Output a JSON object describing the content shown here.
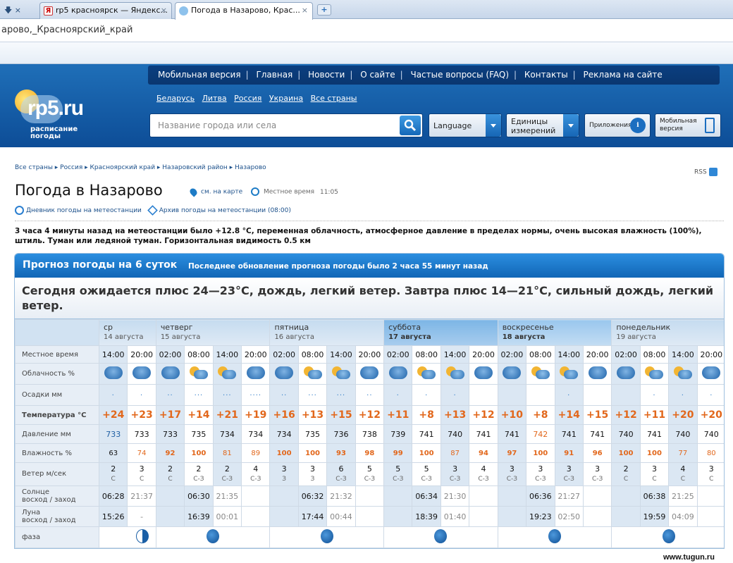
{
  "browser": {
    "tabs": [
      {
        "label": "×",
        "active": false
      },
      {
        "label": "rp5 красноярск — Яндекс...",
        "active": false
      },
      {
        "label": "Погода в Назарово, Крас...",
        "active": true
      }
    ],
    "address": "арово,_Красноярский_край"
  },
  "site": {
    "brand": "rp5.ru",
    "brand_sub1": "расписание",
    "brand_sub2": "погоды",
    "nav": [
      "Мобильная версия",
      "Главная",
      "Новости",
      "О сайте",
      "Частые вопросы (FAQ)",
      "Контакты",
      "Реклама на сайте"
    ],
    "countries": [
      "Беларусь",
      "Литва",
      "Россия",
      "Украина",
      "Все страны"
    ],
    "search_placeholder": "Название города или села",
    "language_label": "Language",
    "units_label_1": "Единицы",
    "units_label_2": "измерений",
    "apps_label": "Приложения",
    "mobile_label_1": "Мобильная",
    "mobile_label_2": "версия"
  },
  "page": {
    "breadcrumb": "Все страны ▸ Россия ▸ Красноярский край ▸ Назаровский район ▸ Назарово",
    "rss": "RSS",
    "title": "Погода в Назарово",
    "on_map": "см. на карте",
    "local_time_label": "Местное время",
    "local_time": "11:05",
    "diary_link": "Дневник погоды на метеостанции",
    "archive_link": "Архив погоды на метеостанции (08:00)",
    "observation": "3 часа 4 минуты назад на метеостанции было +12.8 °C, переменная облачность, атмосферное давление в пределах нормы, очень высокая влажность (100%), штиль. Туман или ледяной туман. Горизонтальная видимость 0.5 км"
  },
  "forecast": {
    "title": "Прогноз погоды на 6 суток",
    "updated": "Последнее обновление прогноза погоды было 2 часа 55 минут назад",
    "today": "Сегодня ожидается плюс 24—23°С, дождь, легкий ветер. Завтра плюс 14—21°С, сильный дождь, легкий ветер.",
    "labels": {
      "local_time": "Местное время",
      "cloudiness": "Облачность %",
      "precip": "Осадки мм",
      "temp": "Температура °C",
      "pressure": "Давление мм",
      "humidity": "Влажность %",
      "wind": "Ветер м/сек",
      "sun_1": "Солнце",
      "sun_2": "восход / заход",
      "moon_1": "Луна",
      "moon_2": "восход / заход",
      "phase": "фаза"
    },
    "days": [
      {
        "name": "ср",
        "date": "14 августа"
      },
      {
        "name": "четверг",
        "date": "15 августа"
      },
      {
        "name": "пятница",
        "date": "16 августа"
      },
      {
        "name": "суббота",
        "date": "17 августа"
      },
      {
        "name": "воскресенье",
        "date": "18 августа"
      },
      {
        "name": "понедельник",
        "date": "19 августа"
      }
    ],
    "hours": [
      "14:00",
      "20:00",
      "02:00",
      "08:00",
      "14:00",
      "20:00",
      "02:00",
      "08:00",
      "14:00",
      "20:00",
      "02:00",
      "08:00",
      "14:00",
      "20:00",
      "02:00",
      "08:00",
      "14:00",
      "20:00",
      "02:00",
      "08:00",
      "14:00",
      "20:00"
    ],
    "temps": [
      "+24",
      "+23",
      "+17",
      "+14",
      "+21",
      "+19",
      "+16",
      "+13",
      "+15",
      "+12",
      "+11",
      "+8",
      "+13",
      "+12",
      "+10",
      "+8",
      "+14",
      "+15",
      "+12",
      "+11",
      "+20",
      "+20"
    ],
    "pressure": [
      "733",
      "733",
      "733",
      "735",
      "734",
      "734",
      "734",
      "735",
      "736",
      "738",
      "739",
      "741",
      "740",
      "741",
      "741",
      "742",
      "741",
      "741",
      "740",
      "741",
      "740",
      "740"
    ],
    "humidity": [
      "63",
      "74",
      "92",
      "100",
      "81",
      "89",
      "100",
      "100",
      "93",
      "98",
      "99",
      "100",
      "87",
      "94",
      "97",
      "100",
      "91",
      "96",
      "100",
      "100",
      "77",
      "80"
    ],
    "wind_speed": [
      "2",
      "3",
      "2",
      "2",
      "2",
      "4",
      "3",
      "3",
      "6",
      "5",
      "5",
      "5",
      "3",
      "4",
      "3",
      "3",
      "3",
      "3",
      "2",
      "3",
      "4",
      "3"
    ],
    "wind_dir": [
      "С",
      "С",
      "С",
      "С-З",
      "С-З",
      "С-З",
      "З",
      "З",
      "С-З",
      "С-З",
      "С-З",
      "С-З",
      "С-З",
      "С-З",
      "С-З",
      "С-З",
      "С-З",
      "С-З",
      "С",
      "С",
      "С",
      "С"
    ],
    "sun": [
      [
        "06:28",
        "21:37"
      ],
      [
        "06:30",
        "21:35"
      ],
      [
        "06:32",
        "21:32"
      ],
      [
        "06:34",
        "21:30"
      ],
      [
        "06:36",
        "21:27"
      ],
      [
        "06:38",
        "21:25"
      ]
    ],
    "moon": [
      [
        "15:26",
        "-"
      ],
      [
        "16:39",
        "00:01"
      ],
      [
        "17:44",
        "00:44"
      ],
      [
        "18:39",
        "01:40"
      ],
      [
        "19:23",
        "02:50"
      ],
      [
        "19:59",
        "04:09"
      ]
    ]
  },
  "watermark": "www.tugun.ru"
}
